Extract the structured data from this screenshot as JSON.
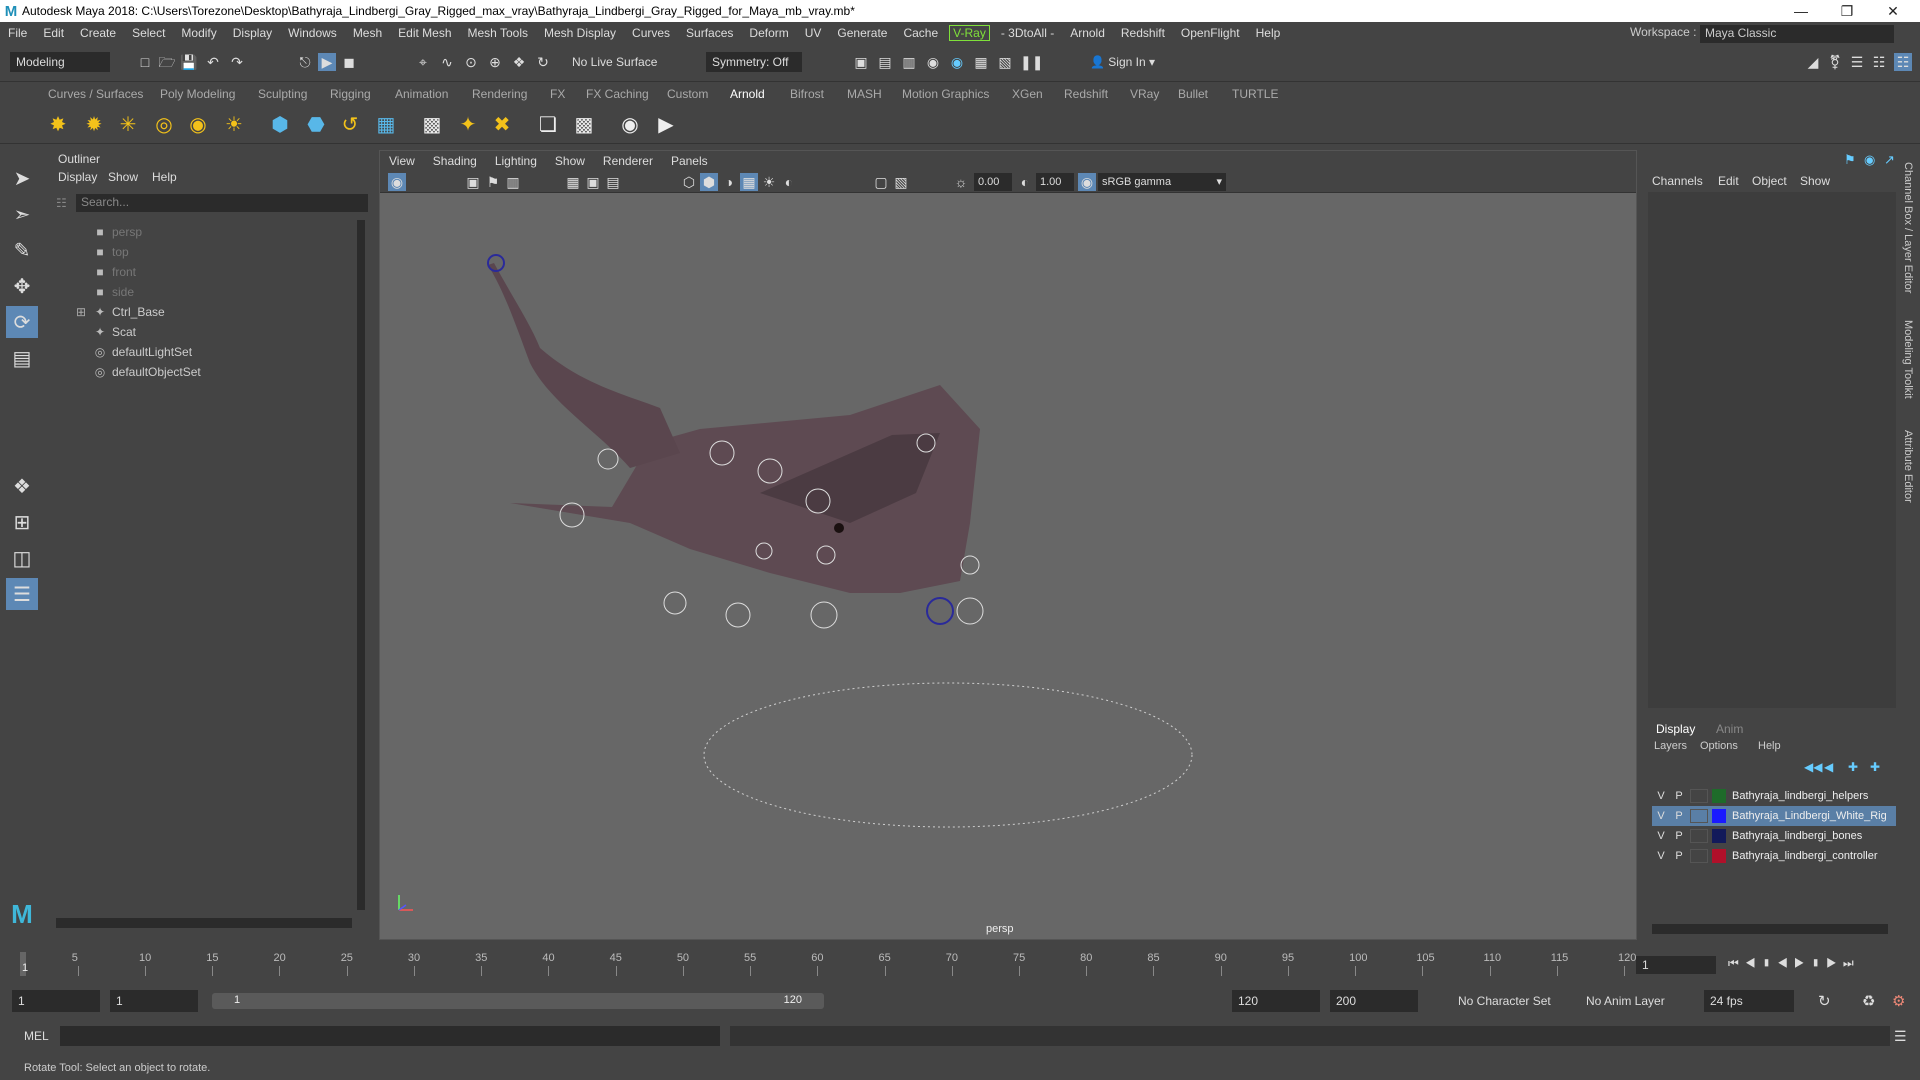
{
  "app": {
    "title": "Autodesk Maya 2018: C:\\Users\\Torezone\\Desktop\\Bathyraja_Lindbergi_Gray_Rigged_max_vray\\Bathyraja_Lindbergi_Gray_Rigged_for_Maya_mb_vray.mb*",
    "logo": "M"
  },
  "menubar": {
    "items": [
      "File",
      "Edit",
      "Create",
      "Select",
      "Modify",
      "Display",
      "Windows",
      "Mesh",
      "Edit Mesh",
      "Mesh Tools",
      "Mesh Display",
      "Curves",
      "Surfaces",
      "Deform",
      "UV",
      "Generate",
      "Cache"
    ],
    "vray": "V-Ray",
    "rest": [
      "- 3DtoAll -",
      "Arnold",
      "Redshift",
      "OpenFlight",
      "Help"
    ],
    "workspace_label": "Workspace :",
    "workspace_value": "Maya Classic"
  },
  "toolbar": {
    "mode": "Modeling",
    "live_surface": "No Live Surface",
    "symmetry": "Symmetry: Off",
    "sign_in": "Sign In"
  },
  "shelf": {
    "tabs": [
      "Curves / Surfaces",
      "Poly Modeling",
      "Sculpting",
      "Rigging",
      "Animation",
      "Rendering",
      "FX",
      "FX Caching",
      "Custom",
      "Arnold",
      "Bifrost",
      "MASH",
      "Motion Graphics",
      "XGen",
      "Redshift",
      "VRay",
      "Bullet",
      "TURTLE"
    ],
    "active": "Arnold"
  },
  "outliner": {
    "title": "Outliner",
    "menu": [
      "Display",
      "Show",
      "Help"
    ],
    "search_placeholder": "Search...",
    "items": [
      {
        "label": "persp",
        "icon": "camera-icon",
        "dim": true
      },
      {
        "label": "top",
        "icon": "camera-icon",
        "dim": true
      },
      {
        "label": "front",
        "icon": "camera-icon",
        "dim": true
      },
      {
        "label": "side",
        "icon": "camera-icon",
        "dim": true
      },
      {
        "label": "Ctrl_Base",
        "icon": "transform-icon",
        "dim": false
      },
      {
        "label": "Scat",
        "icon": "transform-icon",
        "dim": false
      },
      {
        "label": "defaultLightSet",
        "icon": "set-icon",
        "dim": false
      },
      {
        "label": "defaultObjectSet",
        "icon": "set-icon",
        "dim": false
      }
    ]
  },
  "viewport": {
    "menu": [
      "View",
      "Shading",
      "Lighting",
      "Show",
      "Renderer",
      "Panels"
    ],
    "exposure": "0.00",
    "gamma": "1.00",
    "colorspace": "sRGB gamma",
    "camera": "persp"
  },
  "channelbox": {
    "menu": [
      "Channels",
      "Edit",
      "Object",
      "Show"
    ]
  },
  "layers": {
    "tabs": [
      "Display",
      "Anim"
    ],
    "menu": [
      "Layers",
      "Options",
      "Help"
    ],
    "rows": [
      {
        "v": "V",
        "p": "P",
        "color": "#1e6b2a",
        "name": "Bathyraja_lindbergi_helpers",
        "selected": false
      },
      {
        "v": "V",
        "p": "P",
        "color": "#1a1aff",
        "name": "Bathyraja_Lindbergi_White_Rig",
        "selected": true
      },
      {
        "v": "V",
        "p": "P",
        "color": "#121a5a",
        "name": "Bathyraja_lindbergi_bones",
        "selected": false
      },
      {
        "v": "V",
        "p": "P",
        "color": "#b0102a",
        "name": "Bathyraja_lindbergi_controller",
        "selected": false
      }
    ]
  },
  "sidetabs": [
    "Channel Box / Layer Editor",
    "Modeling Toolkit",
    "Attribute Editor"
  ],
  "timeline": {
    "ticks": [
      "5",
      "10",
      "15",
      "20",
      "25",
      "30",
      "35",
      "40",
      "45",
      "50",
      "55",
      "60",
      "65",
      "70",
      "75",
      "80",
      "85",
      "90",
      "95",
      "100",
      "105",
      "110",
      "115",
      "120"
    ],
    "current_frame": "1",
    "frame_field": "1"
  },
  "range": {
    "start": "1",
    "start2": "1",
    "slider_start": "1",
    "slider_end": "120",
    "end": "120",
    "end2": "200",
    "char_set": "No Character Set",
    "anim_layer": "No Anim Layer",
    "fps": "24 fps"
  },
  "mel": {
    "label": "MEL"
  },
  "help": {
    "text": "Rotate Tool: Select an object to rotate."
  }
}
